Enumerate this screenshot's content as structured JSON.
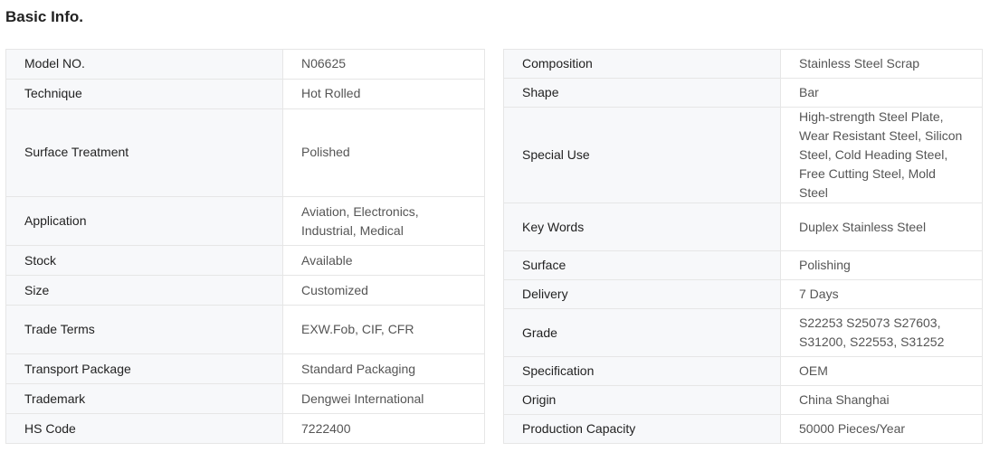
{
  "title": "Basic Info.",
  "left_rows": [
    {
      "label": "Model NO.",
      "value": "N06625"
    },
    {
      "label": "Technique",
      "value": "Hot Rolled"
    },
    {
      "label": "Surface Treatment",
      "value": "Polished"
    },
    {
      "label": "Application",
      "value": "Aviation, Electronics, Industrial, Medical"
    },
    {
      "label": "Stock",
      "value": "Available"
    },
    {
      "label": "Size",
      "value": "Customized"
    },
    {
      "label": "Trade Terms",
      "value": "EXW.Fob, CIF, CFR"
    },
    {
      "label": "Transport Package",
      "value": "Standard Packaging"
    },
    {
      "label": "Trademark",
      "value": "Dengwei International"
    },
    {
      "label": "HS Code",
      "value": "7222400"
    }
  ],
  "right_rows": [
    {
      "label": "Composition",
      "value": "Stainless Steel Scrap"
    },
    {
      "label": "Shape",
      "value": "Bar"
    },
    {
      "label": "Special Use",
      "value": "High-strength Steel Plate, Wear Resistant Steel, Silicon Steel, Cold Heading Steel, Free Cutting Steel, Mold Steel"
    },
    {
      "label": "Key Words",
      "value": "Duplex Stainless Steel"
    },
    {
      "label": "Surface",
      "value": "Polishing"
    },
    {
      "label": "Delivery",
      "value": "7 Days"
    },
    {
      "label": "Grade",
      "value": "S22253 S25073 S27603, S31200, S22553, S31252"
    },
    {
      "label": "Specification",
      "value": "OEM"
    },
    {
      "label": "Origin",
      "value": "China Shanghai"
    },
    {
      "label": "Production Capacity",
      "value": "50000 Pieces/Year"
    }
  ]
}
